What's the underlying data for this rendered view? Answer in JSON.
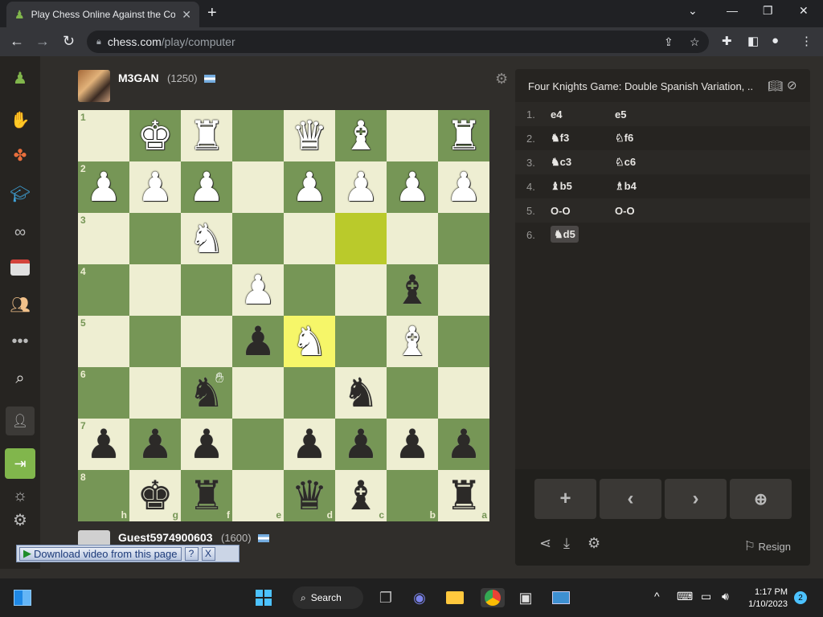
{
  "browser": {
    "tab_title": "Play Chess Online Against the Co",
    "url_host": "chess.com",
    "url_path": "/play/computer"
  },
  "top_player": {
    "name": "M3GAN",
    "rating": "(1250)"
  },
  "bottom_player": {
    "name": "Guest5974900603",
    "rating": "(1600)"
  },
  "board": {
    "ranks": [
      "1",
      "2",
      "3",
      "4",
      "5",
      "6",
      "7",
      "8"
    ],
    "files": [
      "h",
      "g",
      "f",
      "e",
      "d",
      "c",
      "b",
      "a"
    ],
    "squares": [
      [
        "",
        "wK",
        "wR",
        "",
        "wQ",
        "wB",
        "",
        "wR"
      ],
      [
        "wP",
        "wP",
        "wP",
        "",
        "wP",
        "wP",
        "wP",
        "wP"
      ],
      [
        "",
        "",
        "wN",
        "",
        "",
        "",
        "",
        ""
      ],
      [
        "",
        "",
        "",
        "wP",
        "",
        "",
        "bB",
        ""
      ],
      [
        "",
        "",
        "",
        "bP",
        "wN",
        "",
        "wB",
        ""
      ],
      [
        "",
        "",
        "bN",
        "",
        "",
        "bN",
        "",
        ""
      ],
      [
        "bP",
        "bP",
        "bP",
        "",
        "bP",
        "bP",
        "bP",
        "bP"
      ],
      [
        "",
        "bK",
        "bR",
        "",
        "bQ",
        "bB",
        "",
        "bR"
      ]
    ],
    "highlight_from": [
      2,
      5
    ],
    "highlight_to": [
      4,
      4
    ]
  },
  "opening_name": "Four Knights Game: Double Spanish Variation, ...",
  "moves": [
    {
      "num": "1.",
      "white": "e4",
      "black": "e5"
    },
    {
      "num": "2.",
      "white": "♞f3",
      "black": "♘f6"
    },
    {
      "num": "3.",
      "white": "♞c3",
      "black": "♘c6"
    },
    {
      "num": "4.",
      "white": "♝b5",
      "black": "♗b4"
    },
    {
      "num": "5.",
      "white": "O-O",
      "black": "O-O"
    },
    {
      "num": "6.",
      "white": "♞d5",
      "black": ""
    }
  ],
  "controls": {
    "resign_label": "Resign"
  },
  "download_bar": {
    "label": "Download video from this page",
    "help": "?",
    "close": "X"
  },
  "taskbar": {
    "search_label": "Search",
    "time": "1:17 PM",
    "date": "1/10/2023",
    "notifications": "2"
  }
}
